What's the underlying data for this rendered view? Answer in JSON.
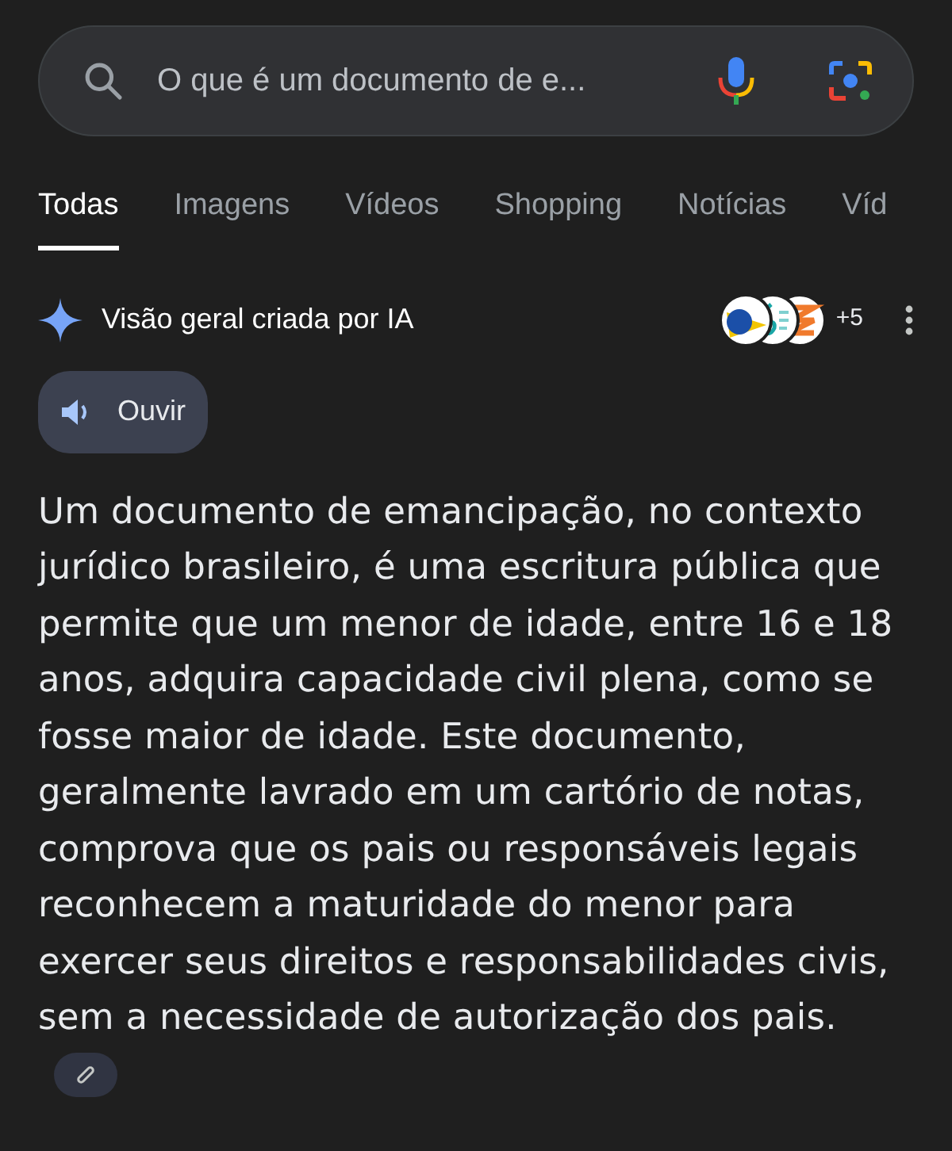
{
  "search": {
    "value": "O que é um documento de e..."
  },
  "tabs": [
    {
      "label": "Todas",
      "selected": true
    },
    {
      "label": "Imagens",
      "selected": false
    },
    {
      "label": "Vídeos",
      "selected": false
    },
    {
      "label": "Shopping",
      "selected": false
    },
    {
      "label": "Notícias",
      "selected": false
    },
    {
      "label": "Víd",
      "selected": false
    }
  ],
  "ai_overview": {
    "title": "Visão geral criada por IA",
    "sources_more": "+5",
    "listen_button": "Ouvir",
    "text": "Um documento de emancipação, no contexto jurídico brasileiro, é uma escritura pública que permite que um menor de idade, entre 16 e 18 anos, adquira capacidade civil plena, como se fosse maior de idade. Este documento, geralmente lavrado em um cartório de notas, comprova que os pais ou responsáveis legais reconhecem a maturidade do menor para exercer seus direitos e responsabilidades civis, sem a necessidade de autorização dos pais."
  }
}
